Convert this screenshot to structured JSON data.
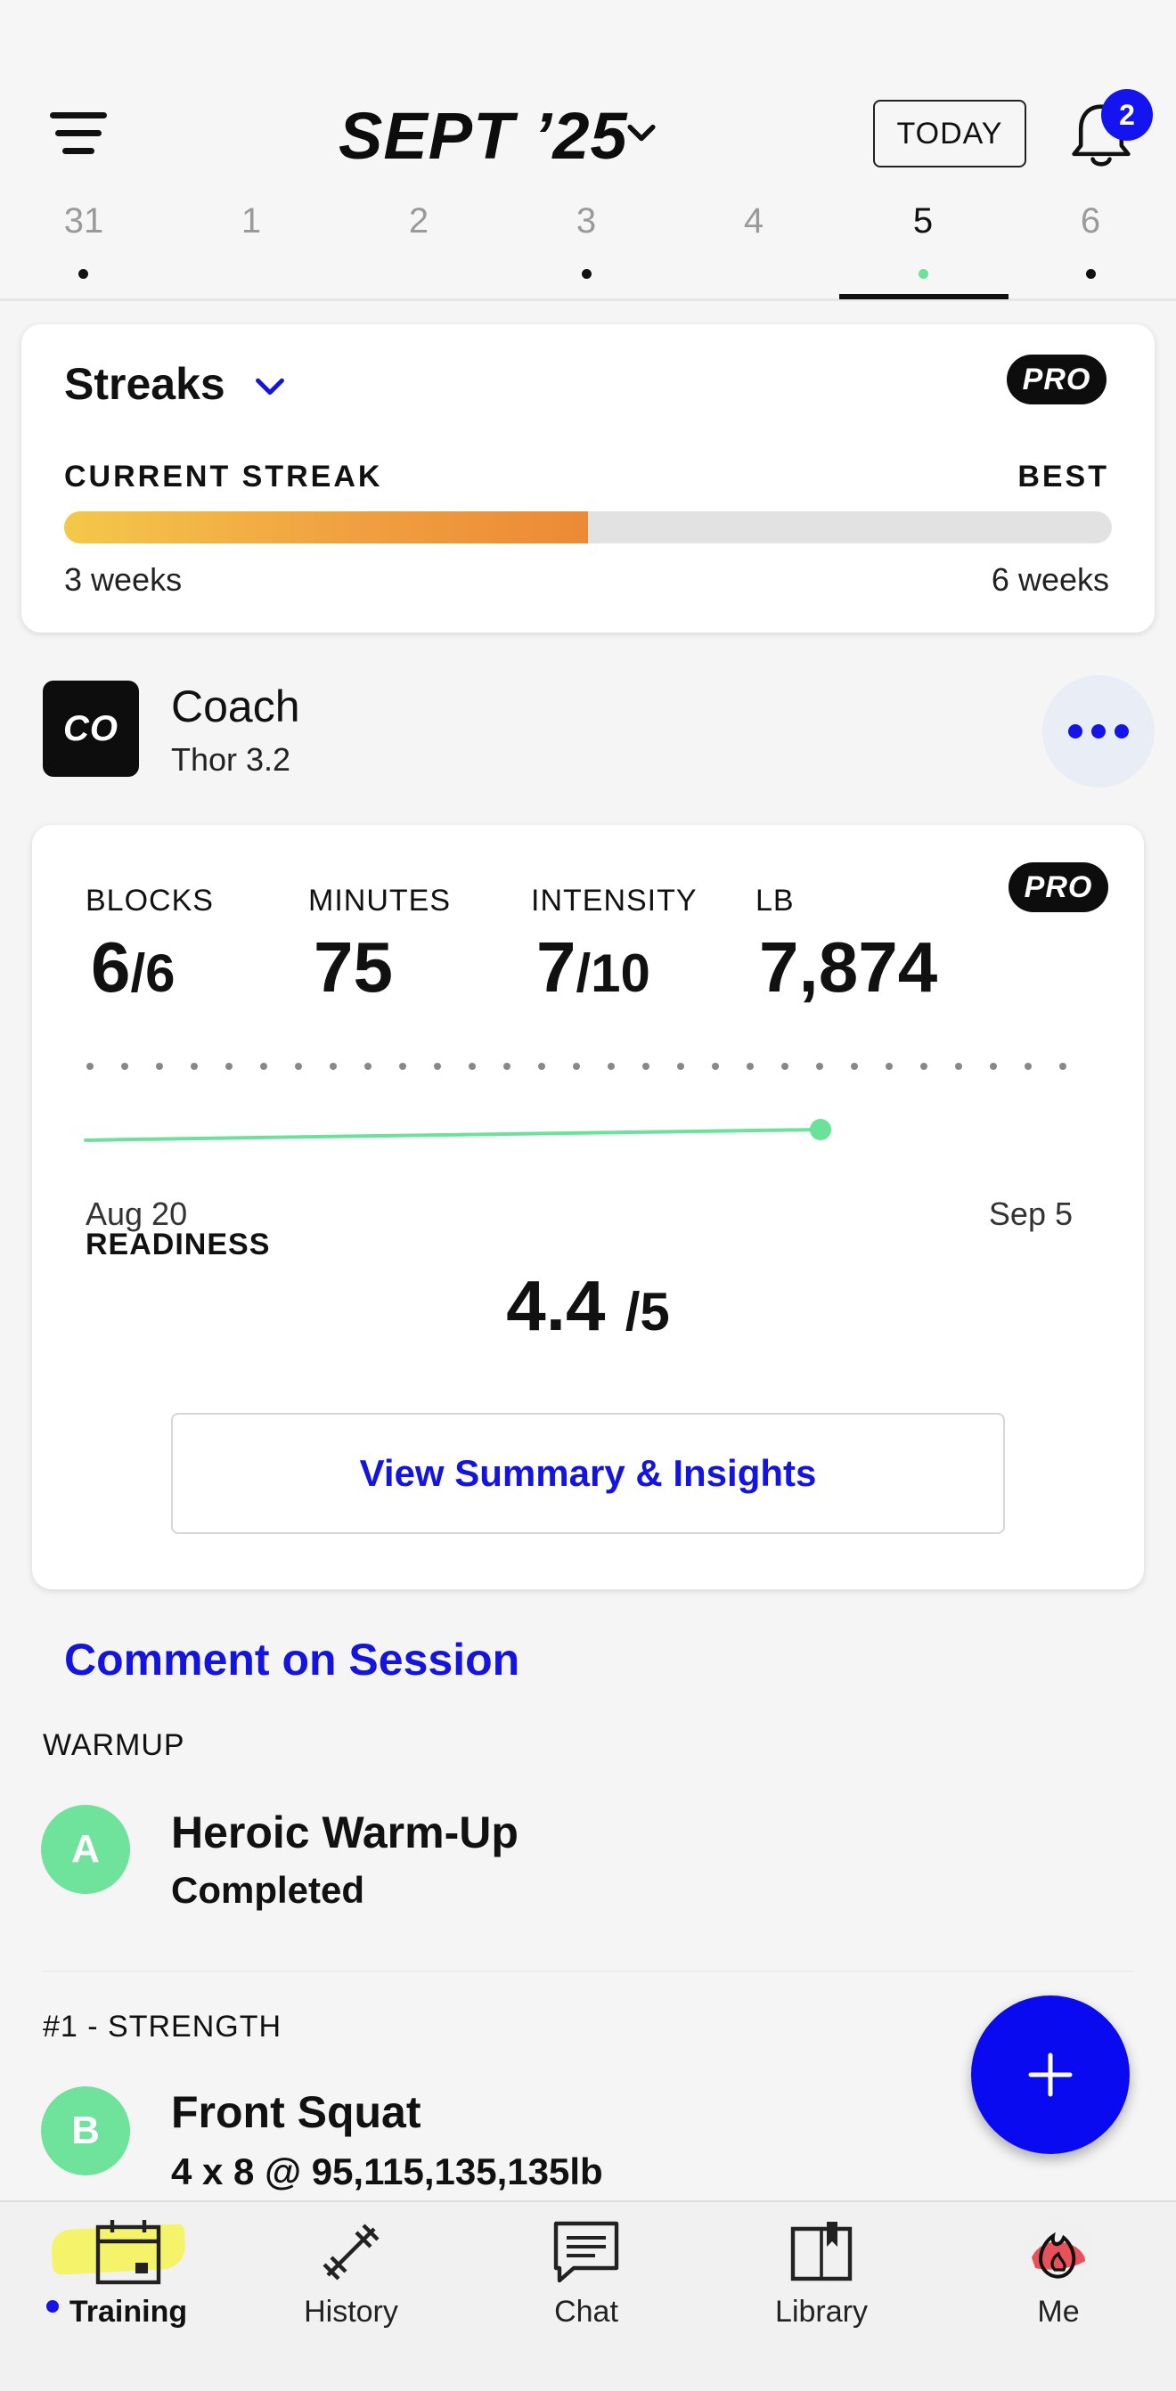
{
  "header": {
    "month": "SEPT ’25",
    "today_label": "TODAY",
    "notification_count": "2",
    "days": [
      {
        "num": "31",
        "dot": "black"
      },
      {
        "num": "1",
        "dot": "none"
      },
      {
        "num": "2",
        "dot": "none"
      },
      {
        "num": "3",
        "dot": "black"
      },
      {
        "num": "4",
        "dot": "none"
      },
      {
        "num": "5",
        "dot": "green",
        "active": true
      },
      {
        "num": "6",
        "dot": "black"
      }
    ]
  },
  "streaks": {
    "title": "Streaks",
    "badge": "PRO",
    "current_label": "CURRENT STREAK",
    "best_label": "BEST",
    "current_value": "3 weeks",
    "best_value": "6 weeks",
    "progress_fraction": 0.5
  },
  "coach": {
    "avatar_text": "CO",
    "name": "Coach",
    "subtitle": "Thor 3.2"
  },
  "stats": {
    "badge": "PRO",
    "blocks_label": "BLOCKS",
    "blocks_value": "6",
    "blocks_total": "/6",
    "minutes_label": "MINUTES",
    "minutes_value": "75",
    "intensity_label": "INTENSITY",
    "intensity_value": "7",
    "intensity_total": "/10",
    "lb_label": "LB",
    "lb_value": "7,874",
    "date_start": "Aug 20",
    "date_end": "Sep 5",
    "readiness_label": "READINESS",
    "readiness_value": "4.4",
    "readiness_total": "/5",
    "summary_button": "View Summary & Insights"
  },
  "session": {
    "comment_link": "Comment on Session",
    "blocks": [
      {
        "section": "WARMUP",
        "letter": "A",
        "title": "Heroic Warm-Up",
        "subtitle": "Completed"
      },
      {
        "section": "#1 - STRENGTH",
        "letter": "B",
        "title": "Front Squat",
        "subtitle": "4 x 8 @ 95,115,135,135lb"
      }
    ]
  },
  "nav": {
    "items": [
      {
        "label": "Training",
        "icon": "calendar-icon",
        "active": true
      },
      {
        "label": "History",
        "icon": "barbell-icon"
      },
      {
        "label": "Chat",
        "icon": "chat-icon"
      },
      {
        "label": "Library",
        "icon": "book-icon"
      },
      {
        "label": "Me",
        "icon": "profile-avatar"
      }
    ]
  },
  "colors": {
    "accent": "#1414e0",
    "green": "#6fe29c",
    "streak_start": "#f4c84a",
    "streak_end": "#ec8a36"
  }
}
